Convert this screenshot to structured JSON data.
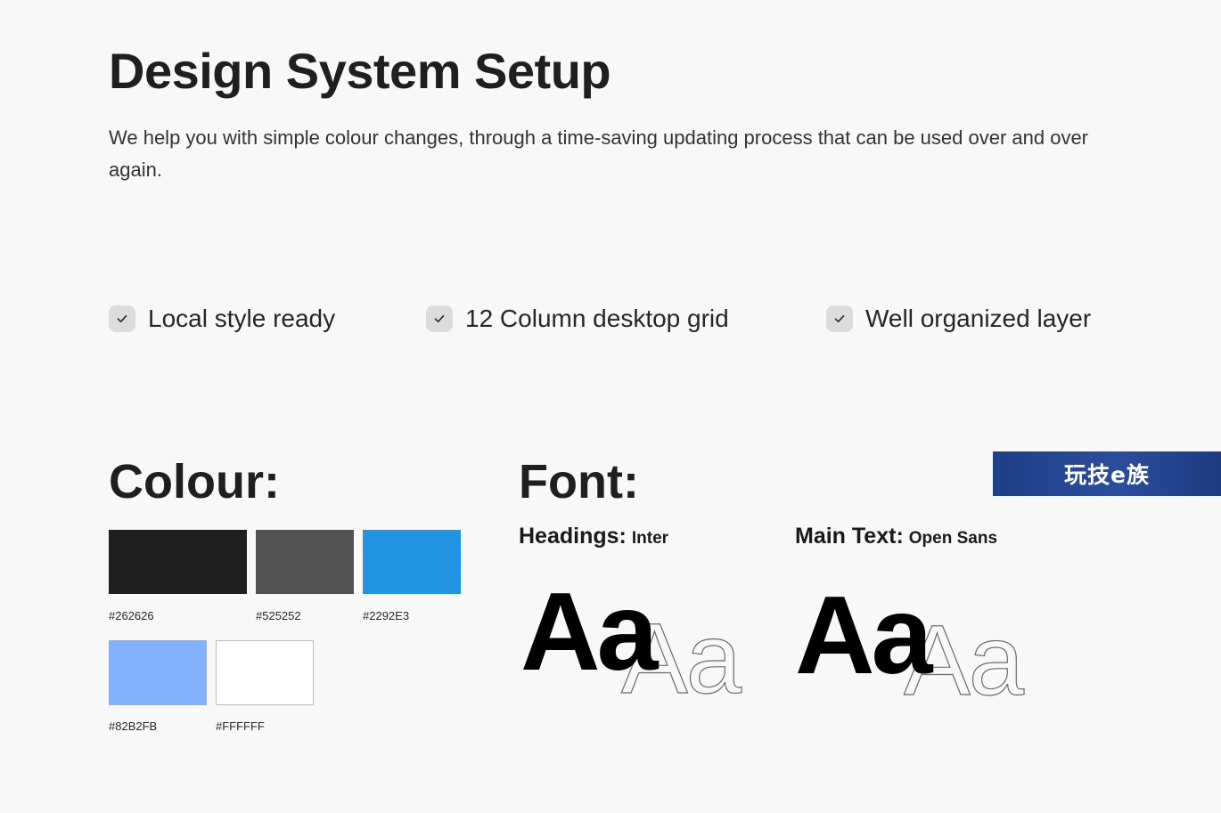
{
  "header": {
    "title": "Design System Setup",
    "subtitle": "We help you with simple colour changes, through a time-saving updating process that can be used over and over again."
  },
  "features": [
    {
      "label": "Local style ready",
      "icon": "check-icon"
    },
    {
      "label": "12 Column desktop grid",
      "icon": "check-icon"
    },
    {
      "label": "Well organized layer",
      "icon": "check-icon"
    }
  ],
  "colour": {
    "title": "Colour:",
    "swatches": [
      {
        "code": "#262626",
        "color": "#1f1f1f"
      },
      {
        "code": "#525252",
        "color": "#525252"
      },
      {
        "code": "#2292E3",
        "color": "#2292E3"
      },
      {
        "code": "#82B2FB",
        "color": "#82B2FB"
      },
      {
        "code": "#FFFFFF",
        "color": "#FFFFFF"
      }
    ]
  },
  "font": {
    "title": "Font:",
    "headings": {
      "label": "Headings:",
      "value": "Inter",
      "sample": "Aa"
    },
    "main_text": {
      "label": "Main Text:",
      "value": "Open Sans",
      "sample": "Aa"
    }
  },
  "watermark": {
    "text": "玩技e族"
  }
}
